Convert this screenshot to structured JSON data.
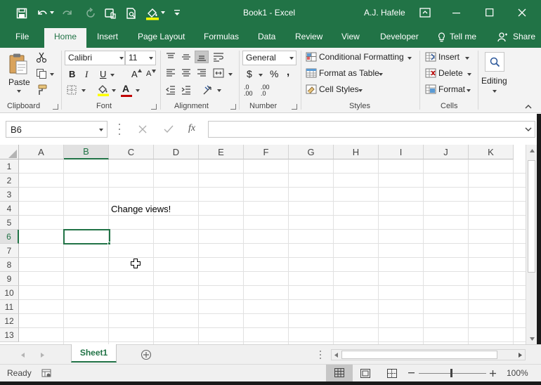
{
  "window": {
    "title": "Book1 - Excel",
    "user": "A.J. Hafele"
  },
  "tabs": [
    "File",
    "Home",
    "Insert",
    "Page Layout",
    "Formulas",
    "Data",
    "Review",
    "View",
    "Developer"
  ],
  "tell_me": "Tell me",
  "share": "Share",
  "ribbon": {
    "clipboard": {
      "label": "Clipboard",
      "paste": "Paste"
    },
    "font": {
      "label": "Font",
      "name": "Calibri",
      "size": "11",
      "bold": "B",
      "italic": "I",
      "underline": "U",
      "grow": "A",
      "shrink": "A",
      "color_letter": "A"
    },
    "alignment": {
      "label": "Alignment"
    },
    "number": {
      "label": "Number",
      "format": "General",
      "currency": "$",
      "percent": "%",
      "comma": ",",
      "inc_decimal": ".0 .00",
      "dec_decimal": ".00 .0"
    },
    "styles": {
      "label": "Styles",
      "conditional": "Conditional Formatting",
      "format_table": "Format as Table",
      "cell_styles": "Cell Styles"
    },
    "cells": {
      "label": "Cells",
      "insert": "Insert",
      "delete": "Delete",
      "format": "Format"
    },
    "editing": {
      "label": "Editing"
    }
  },
  "formula_bar": {
    "name_box": "B6",
    "fx": "fx",
    "value": ""
  },
  "grid": {
    "columns": [
      "A",
      "B",
      "C",
      "D",
      "E",
      "F",
      "G",
      "H",
      "I",
      "J",
      "K"
    ],
    "rows": [
      "1",
      "2",
      "3",
      "4",
      "5",
      "6",
      "7",
      "8",
      "9",
      "10",
      "11",
      "12",
      "13"
    ],
    "selected_cell": "B6",
    "cells": [
      {
        "ref": "C4",
        "text": "Change views!"
      }
    ]
  },
  "sheets": {
    "tabs": [
      "Sheet1"
    ],
    "active": "Sheet1"
  },
  "status": {
    "mode": "Ready",
    "zoom": "100%"
  },
  "colors": {
    "accent": "#217346",
    "ribbon_bg": "#f3f3f3",
    "grid_line": "#e1e1e1",
    "font_red": "#c00000",
    "highlight_yellow": "#ffff00"
  }
}
